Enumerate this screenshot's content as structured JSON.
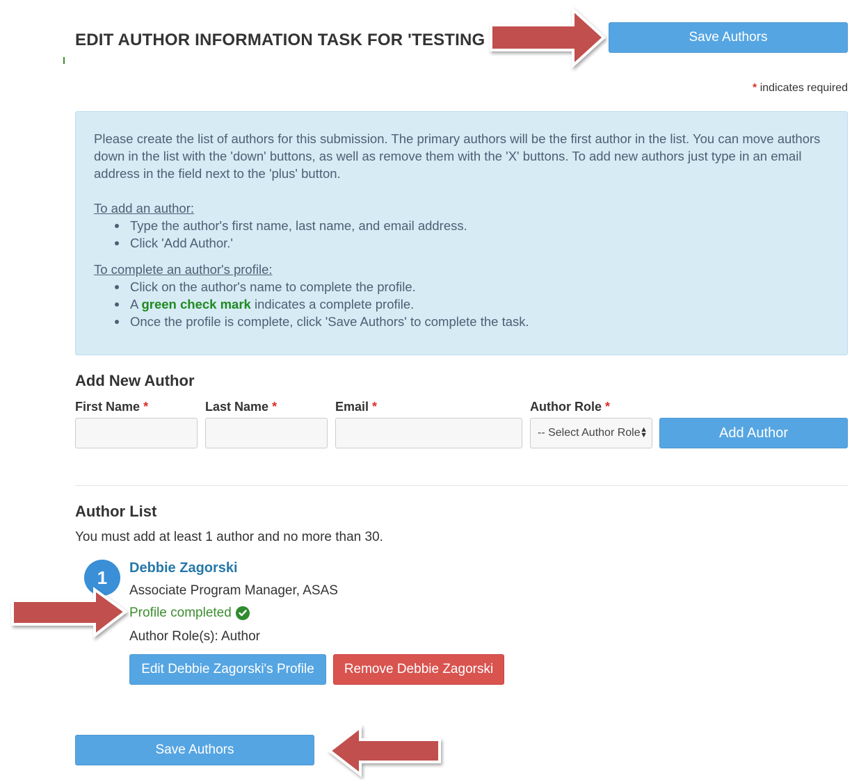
{
  "header": {
    "title": "EDIT AUTHOR INFORMATION TASK FOR 'TESTING THE SYSTEM'",
    "save_top_label": "Save Authors"
  },
  "required_note": {
    "star": "*",
    "text": "indicates required"
  },
  "info": {
    "intro": "Please create the list of authors for this submission. The primary authors will be the first author in the list. You can move authors down in the list with the 'down' buttons, as well as remove them with the 'X' buttons. To add new authors just type in an email address in the field next to the 'plus' button.",
    "add_heading": "To add an author:",
    "add_steps": [
      "Type the author's first name, last name, and email address.",
      "Click 'Add Author.'"
    ],
    "complete_heading": "To complete an author's profile:",
    "complete_step_1": "Click on the author's name to complete the profile.",
    "complete_step_2_prefix": "A",
    "complete_step_2_emphasis": "green check mark",
    "complete_step_2_suffix": "indicates a complete profile.",
    "complete_step_3": "Once the profile is complete, click 'Save Authors' to complete the task."
  },
  "add_author": {
    "heading": "Add New Author",
    "first_name_label": "First Name",
    "last_name_label": "Last Name",
    "email_label": "Email",
    "role_label": "Author Role",
    "required_star": "*",
    "first_name_value": "",
    "last_name_value": "",
    "email_value": "",
    "role_selected": "-- Select Author Role --",
    "add_button_label": "Add Author"
  },
  "author_list": {
    "heading": "Author List",
    "note": "You must add at least 1 author and no more than 30.",
    "authors": [
      {
        "number": "1",
        "name": "Debbie Zagorski",
        "title": "Associate Program Manager, ASAS",
        "status": "Profile completed",
        "roles": "Author Role(s): Author",
        "edit_label": "Edit Debbie Zagorski's Profile",
        "remove_label": "Remove Debbie Zagorski"
      }
    ]
  },
  "footer": {
    "save_bottom_label": "Save Authors"
  },
  "colors": {
    "primary_button": "#55a5e2",
    "danger_button": "#d9534f",
    "info_background": "#d7ebf5",
    "success_text": "#3c8d2f",
    "annotation_arrow": "#c0504d"
  }
}
